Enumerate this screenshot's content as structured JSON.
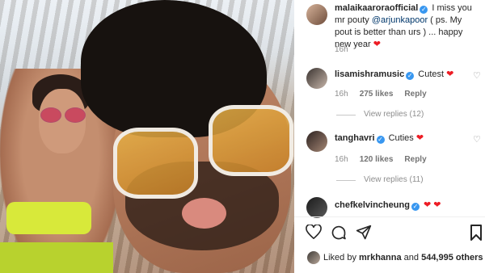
{
  "caption": {
    "username": "malaikaaroraofficial",
    "text_part1": "I miss you mr pouty ",
    "mention": "@arjunkapoor",
    "text_part2": " ( ps. My pout is better than urs ) ... happy new year ",
    "emoji": "❤",
    "time": "16h"
  },
  "comments": [
    {
      "username": "lisamishramusic",
      "text": "Cutest ",
      "emoji": "❤",
      "time": "16h",
      "likes": "275 likes",
      "reply": "Reply",
      "view_replies": "View replies (12)"
    },
    {
      "username": "tanghavri",
      "text": "Cuties ",
      "emoji": "❤",
      "time": "16h",
      "likes": "120 likes",
      "reply": "Reply",
      "view_replies": "View replies (11)"
    },
    {
      "username": "chefkelvincheung",
      "text": "",
      "emoji": "❤ ❤"
    }
  ],
  "actions": {
    "like_icon": "heart-outline-icon",
    "comment_icon": "comment-bubble-icon",
    "share_icon": "paper-plane-icon"
  },
  "likes_summary": {
    "prefix": "Liked by ",
    "user": "mrkhanna",
    "middle": " and ",
    "count": "544,995 others"
  },
  "colors": {
    "verified": "#3897f0",
    "heart": "#ed1c24",
    "link": "#00376b"
  }
}
